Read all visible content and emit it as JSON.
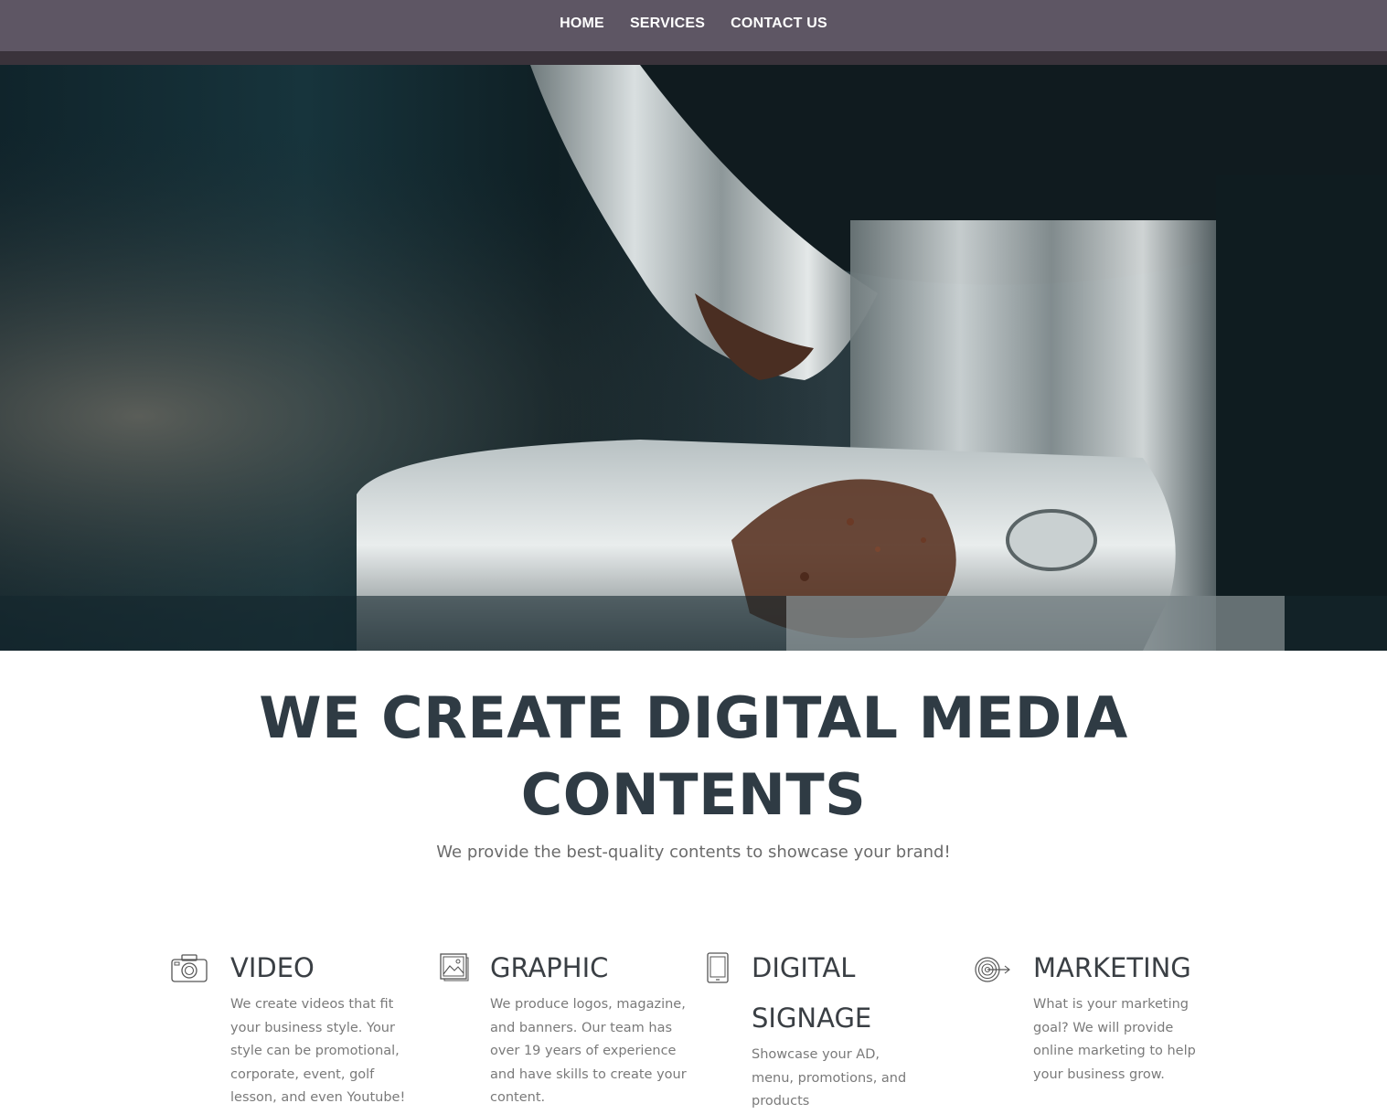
{
  "nav": {
    "items": [
      {
        "label": "HOME"
      },
      {
        "label": "SERVICES"
      },
      {
        "label": "CONTACT US"
      }
    ]
  },
  "hero": {
    "image": "coffee-grinder-photo"
  },
  "intro": {
    "headline_line1": "WE CREATE DIGITAL MEDIA",
    "headline_line2": "CONTENTS",
    "subtitle": "We provide the best-quality contents to showcase your brand!"
  },
  "services": [
    {
      "icon": "camera-icon",
      "title": "VIDEO",
      "text": "We create videos that fit your business style. Your style can be promotional, corporate, event, golf lesson, and even Youtube!"
    },
    {
      "icon": "image-icon",
      "title": "GRAPHIC",
      "text": "We produce logos, magazine, and banners. Our team has over 19 years of experience and have skills to create your content."
    },
    {
      "icon": "tablet-icon",
      "title": "DIGITAL SIGNAGE",
      "text": "Showcase your AD, menu, promotions, and products"
    },
    {
      "icon": "target-icon",
      "title": "MARKETING",
      "text": "What is your marketing goal? We will provide online marketing to help your business grow."
    }
  ],
  "colors": {
    "nav_bg": "#5e5664",
    "heading": "#2f3b44",
    "body_text": "#7a7a7a"
  }
}
